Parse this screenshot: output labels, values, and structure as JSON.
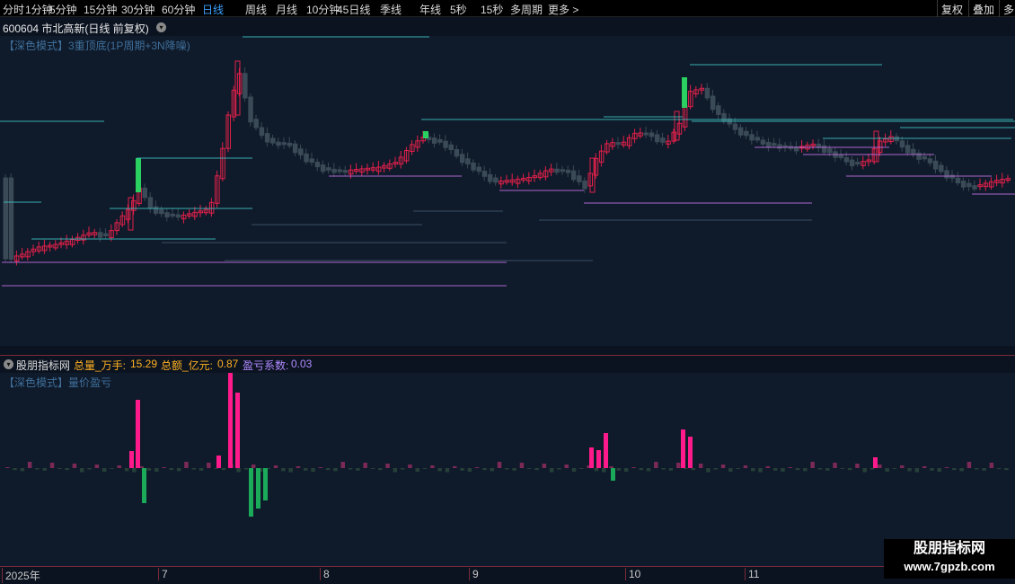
{
  "topbar": {
    "period_tabs": [
      "分时",
      "1分钟",
      "5分钟",
      "15分钟",
      "30分钟",
      "60分钟",
      "日线",
      "周线",
      "月线",
      "10分钟",
      "45日线",
      "季线",
      "年线",
      "5秒",
      "15秒",
      "多周期",
      "更多 >"
    ],
    "active_tab": "日线",
    "right_buttons": [
      "复权",
      "叠加",
      "多"
    ]
  },
  "stock": {
    "title": "600604 市北高新(日线 前复权)"
  },
  "main_panel": {
    "indicator_label": "【深色模式】3重顶底(1P周期+3N降噪)"
  },
  "sub_panel": {
    "name": "股朋指标网",
    "stat1_label": "总量_万手:",
    "stat1_value": "15.29",
    "stat2_label": "总额_亿元:",
    "stat2_value": "0.87",
    "stat3_label": "盈亏系数:",
    "stat3_value": "0.03",
    "indicator_label": "【深色模式】量价盈亏"
  },
  "date_axis": [
    "2025年",
    "7",
    "8",
    "9",
    "10",
    "11"
  ],
  "watermark": {
    "line1": "股朋指标网",
    "line2": "www.7gpzb.com"
  },
  "colors": {
    "up": "#e0204a",
    "down": "#3a4a56",
    "big_up": "#2ad060",
    "resistance": "#3ec8c8",
    "support": "#c070e0",
    "bar_pos": "#ff1a8c",
    "bar_neg": "#1aaa5a",
    "stat1": "#ffb020",
    "stat2": "#ffb020",
    "stat3": "#b08aff"
  }
}
